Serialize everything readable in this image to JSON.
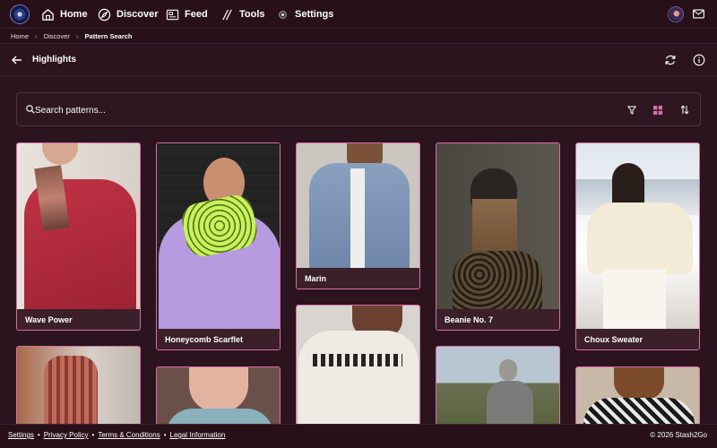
{
  "nav": {
    "items": [
      {
        "label": "Home",
        "icon": "home-icon"
      },
      {
        "label": "Discover",
        "icon": "compass-icon"
      },
      {
        "label": "Feed",
        "icon": "feed-icon"
      },
      {
        "label": "Tools",
        "icon": "tools-icon"
      },
      {
        "label": "Settings",
        "icon": "gear-icon"
      }
    ]
  },
  "breadcrumb": {
    "items": [
      "Home",
      "Discover"
    ],
    "current": "Pattern Search"
  },
  "header": {
    "title": "Highlights"
  },
  "search": {
    "placeholder": "Search patterns..."
  },
  "cards": [
    {
      "label": "Wave Power"
    },
    {
      "label": "Honeycomb Scarflet"
    },
    {
      "label": "Marin"
    },
    {
      "label": "Beanie No. 7"
    },
    {
      "label": "Choux Sweater"
    }
  ],
  "footer": {
    "links": [
      "Settings",
      "Privacy Policy",
      "Terms & Conditions",
      "Legal Information"
    ],
    "copyright": "© 2026 Stash2Go"
  },
  "colors": {
    "background": "#2b141d",
    "accent": "#d86ea8",
    "card_label_bg": "#3b2029"
  }
}
